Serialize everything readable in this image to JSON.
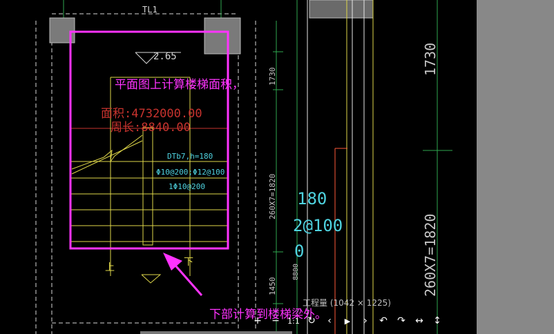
{
  "drawing": {
    "beam_label": "TL1",
    "elevation": "2.65",
    "area_text": "面积:4732000.00",
    "perimeter_text": "周长:8840.00",
    "dim_top": "1730",
    "dim_mid": "260X7=1820",
    "dim_bottom": "1450",
    "dim_side": "8800",
    "dim_right_top": "1730",
    "dim_right_bottom": "260X7=1820",
    "stair_label": "DTb7,h=180",
    "rebar_1": "Φ10@200;Φ12@100",
    "rebar_2": "1Φ10@200",
    "big_180": "180",
    "big_rebar": "2@100",
    "big_0": "0",
    "up_label": "上",
    "down_label": "下"
  },
  "annotations": {
    "top_note": "平面图上计算楼梯面积，",
    "bottom_note": "下部计算到楼梯梁外。",
    "color": "#ff33ff"
  },
  "viewer": {
    "caption": "工程量 (1042 × 1225)",
    "tools": [
      {
        "name": "zoom-in-icon",
        "glyph": "+"
      },
      {
        "name": "zoom-out-icon",
        "glyph": "−"
      },
      {
        "name": "actual-size-icon",
        "glyph": "1:1"
      },
      {
        "name": "refresh-icon",
        "glyph": "↻"
      },
      {
        "name": "previous-icon",
        "glyph": "‹"
      },
      {
        "name": "play-icon",
        "glyph": "▶"
      },
      {
        "name": "next-icon",
        "glyph": "›"
      },
      {
        "name": "rotate-left-icon",
        "glyph": "↶"
      },
      {
        "name": "rotate-right-icon",
        "glyph": "↷"
      },
      {
        "name": "flip-horizontal-icon",
        "glyph": "↔"
      },
      {
        "name": "flip-vertical-icon",
        "glyph": "↕"
      }
    ]
  }
}
